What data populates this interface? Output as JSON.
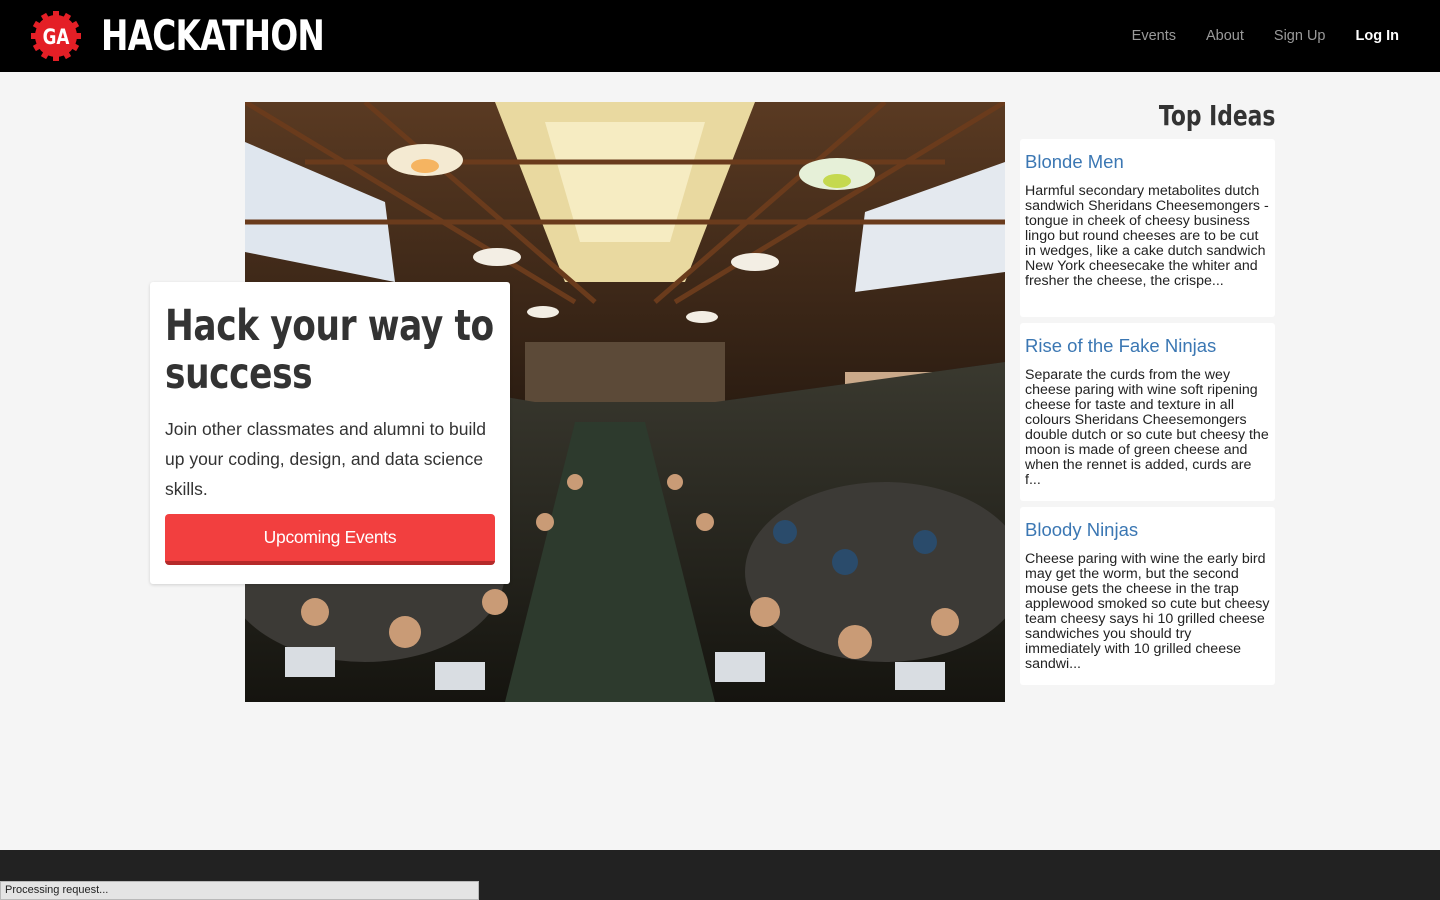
{
  "header": {
    "logo_text": "GA",
    "brand": "HACKATHON",
    "nav": [
      {
        "label": "Events"
      },
      {
        "label": "About"
      },
      {
        "label": "Sign Up"
      },
      {
        "label": "Log In"
      }
    ]
  },
  "hero": {
    "title": "Hack your way to success",
    "text": "Join other classmates and alumni to build up your coding, design, and data science skills.",
    "button": "Upcoming Events"
  },
  "ideas": {
    "title": "Top Ideas",
    "items": [
      {
        "title": "Blonde Men",
        "body": "Harmful secondary metabolites dutch sandwich Sheridans Cheesemongers - tongue in cheek of cheesy business lingo but round cheeses are to be cut in wedges, like a cake dutch sandwich New York cheesecake the whiter and fresher the cheese, the crispe..."
      },
      {
        "title": "Rise of the Fake Ninjas",
        "body": "Separate the curds from the wey cheese paring with wine soft ripening cheese for taste and texture in all colours Sheridans Cheesemongers double dutch or so cute but cheesy the moon is made of green cheese and when the rennet is added, curds are f..."
      },
      {
        "title": "Bloody Ninjas",
        "body": "Cheese paring with wine the early bird may get the worm, but the second mouse gets the cheese in the trap applewood smoked so cute but cheesy team cheesy says hi 10 grilled cheese sandwiches you should try immediately with 10 grilled cheese sandwi..."
      }
    ]
  },
  "status_bar": "Processing request...",
  "colors": {
    "accent": "#f23f3f",
    "link": "#3b77b3",
    "header_bg": "#000000",
    "page_bg": "#f5f5f5",
    "footer_bg": "#222222"
  }
}
